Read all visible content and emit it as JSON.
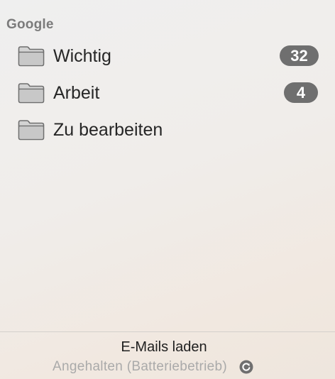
{
  "sidebar": {
    "section_title": "Google",
    "folders": [
      {
        "label": "Wichtig",
        "count": "32",
        "icon": "folder-icon"
      },
      {
        "label": "Arbeit",
        "count": "4",
        "icon": "folder-icon"
      },
      {
        "label": "Zu bearbeiten",
        "icon": "folder-icon"
      }
    ]
  },
  "footer": {
    "title": "E-Mails laden",
    "status": "Angehalten (Batteriebetrieb)",
    "icon": "refresh-icon"
  },
  "colors": {
    "badge": "#6f6f6f",
    "section_header": "#7b7b7b",
    "status_text": "#aaaaaa"
  }
}
